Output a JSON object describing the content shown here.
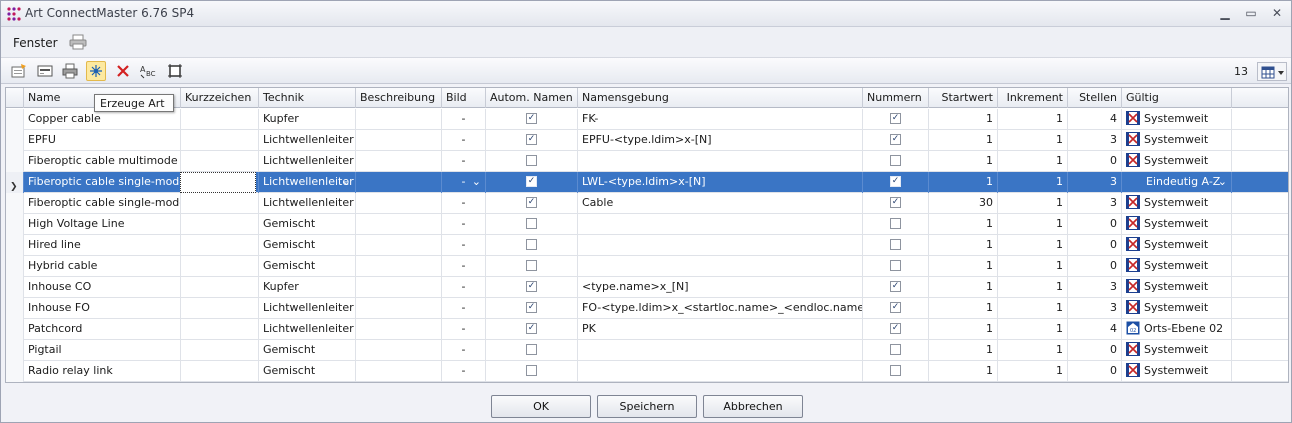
{
  "window": {
    "title": "Art ConnectMaster 6.76 SP4"
  },
  "menu": {
    "fenster": "Fenster"
  },
  "toolbar": {
    "tooltip": "Erzeuge Art",
    "count": "13"
  },
  "columns": [
    "Name",
    "Kurzzeichen",
    "Technik",
    "Beschreibung",
    "Bild",
    "Autom. Namen",
    "Namensgebung",
    "Nummern",
    "Startwert",
    "Inkrement",
    "Stellen",
    "Gültig"
  ],
  "rows": [
    {
      "name": "Copper cable",
      "kurz": "",
      "technik": "Kupfer",
      "beschreibung": "",
      "bild": "-",
      "autom": true,
      "namensgebung": "FK-",
      "nummern": true,
      "startwert": "1",
      "inkrement": "1",
      "stellen": "4",
      "gueltig": "Systemweit",
      "icon": "systemweit"
    },
    {
      "name": "EPFU",
      "kurz": "",
      "technik": "Lichtwellenleiter",
      "beschreibung": "",
      "bild": "-",
      "autom": true,
      "namensgebung": "EPFU-<type.ldim>x-[N]",
      "nummern": true,
      "startwert": "1",
      "inkrement": "1",
      "stellen": "3",
      "gueltig": "Systemweit",
      "icon": "systemweit"
    },
    {
      "name": "Fiberoptic cable multimode",
      "kurz": "",
      "technik": "Lichtwellenleiter",
      "beschreibung": "",
      "bild": "-",
      "autom": false,
      "namensgebung": "",
      "nummern": false,
      "startwert": "1",
      "inkrement": "1",
      "stellen": "0",
      "gueltig": "Systemweit",
      "icon": "systemweit"
    },
    {
      "name": "Fiberoptic cable single-mode",
      "kurz": "",
      "technik": "Lichtwellenleiter",
      "beschreibung": "",
      "bild": "-",
      "autom": true,
      "namensgebung": "LWL-<type.ldim>x-[N]",
      "nummern": true,
      "startwert": "1",
      "inkrement": "1",
      "stellen": "3",
      "gueltig": "Eindeutig A-Z",
      "icon": "none",
      "selected": true
    },
    {
      "name": "Fiberoptic cable single-mode SP",
      "kurz": "",
      "technik": "Lichtwellenleiter",
      "beschreibung": "",
      "bild": "-",
      "autom": true,
      "namensgebung": "Cable",
      "nummern": true,
      "startwert": "30",
      "inkrement": "1",
      "stellen": "3",
      "gueltig": "Systemweit",
      "icon": "systemweit"
    },
    {
      "name": "High Voltage Line",
      "kurz": "",
      "technik": "Gemischt",
      "beschreibung": "",
      "bild": "-",
      "autom": false,
      "namensgebung": "",
      "nummern": false,
      "startwert": "1",
      "inkrement": "1",
      "stellen": "0",
      "gueltig": "Systemweit",
      "icon": "systemweit"
    },
    {
      "name": "Hired line",
      "kurz": "",
      "technik": "Gemischt",
      "beschreibung": "",
      "bild": "-",
      "autom": false,
      "namensgebung": "",
      "nummern": false,
      "startwert": "1",
      "inkrement": "1",
      "stellen": "0",
      "gueltig": "Systemweit",
      "icon": "systemweit"
    },
    {
      "name": "Hybrid cable",
      "kurz": "",
      "technik": "Gemischt",
      "beschreibung": "",
      "bild": "-",
      "autom": false,
      "namensgebung": "",
      "nummern": false,
      "startwert": "1",
      "inkrement": "1",
      "stellen": "0",
      "gueltig": "Systemweit",
      "icon": "systemweit"
    },
    {
      "name": "Inhouse CO",
      "kurz": "",
      "technik": "Kupfer",
      "beschreibung": "",
      "bild": "-",
      "autom": true,
      "namensgebung": "<type.name>x_[N]",
      "nummern": true,
      "startwert": "1",
      "inkrement": "1",
      "stellen": "3",
      "gueltig": "Systemweit",
      "icon": "systemweit"
    },
    {
      "name": "Inhouse FO",
      "kurz": "",
      "technik": "Lichtwellenleiter",
      "beschreibung": "",
      "bild": "-",
      "autom": true,
      "namensgebung": "FO-<type.ldim>x_<startloc.name>_<endloc.name>_[N]",
      "nummern": true,
      "startwert": "1",
      "inkrement": "1",
      "stellen": "3",
      "gueltig": "Systemweit",
      "icon": "systemweit"
    },
    {
      "name": "Patchcord",
      "kurz": "",
      "technik": "Lichtwellenleiter",
      "beschreibung": "",
      "bild": "-",
      "autom": true,
      "namensgebung": "PK",
      "nummern": true,
      "startwert": "1",
      "inkrement": "1",
      "stellen": "4",
      "gueltig": "Orts-Ebene 02",
      "icon": "ortsebene"
    },
    {
      "name": "Pigtail",
      "kurz": "",
      "technik": "Gemischt",
      "beschreibung": "",
      "bild": "-",
      "autom": false,
      "namensgebung": "",
      "nummern": false,
      "startwert": "1",
      "inkrement": "1",
      "stellen": "0",
      "gueltig": "Systemweit",
      "icon": "systemweit"
    },
    {
      "name": "Radio relay link",
      "kurz": "",
      "technik": "Gemischt",
      "beschreibung": "",
      "bild": "-",
      "autom": false,
      "namensgebung": "",
      "nummern": false,
      "startwert": "1",
      "inkrement": "1",
      "stellen": "0",
      "gueltig": "Systemweit",
      "icon": "systemweit"
    }
  ],
  "buttons": {
    "ok": "OK",
    "speichern": "Speichern",
    "abbrechen": "Abbrechen"
  },
  "colors": {
    "selection": "#3a75c5",
    "header": "#e9ecf2"
  }
}
